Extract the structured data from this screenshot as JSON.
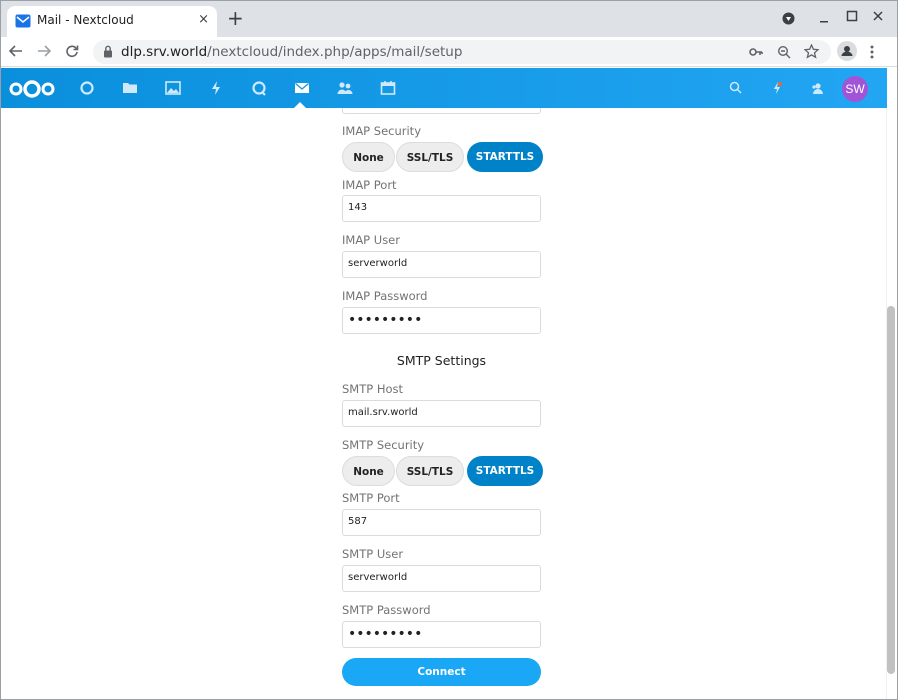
{
  "browser": {
    "tab_title": "Mail - Nextcloud",
    "tab_close": "×",
    "new_tab": "+",
    "url_host": "dlp.srv.world",
    "url_path": "/nextcloud/index.php/apps/mail/setup"
  },
  "header": {
    "avatar_initials": "SW",
    "accent_color": "#0082c9"
  },
  "imap": {
    "security_label": "IMAP Security",
    "security_options": [
      "None",
      "SSL/TLS",
      "STARTTLS"
    ],
    "security_selected": "STARTTLS",
    "port_label": "IMAP Port",
    "port_value": "143",
    "user_label": "IMAP User",
    "user_value": "serverworld",
    "password_label": "IMAP Password",
    "password_value": "•••••••••"
  },
  "smtp": {
    "section_title": "SMTP Settings",
    "host_label": "SMTP Host",
    "host_value": "mail.srv.world",
    "security_label": "SMTP Security",
    "security_options": [
      "None",
      "SSL/TLS",
      "STARTTLS"
    ],
    "security_selected": "STARTTLS",
    "port_label": "SMTP Port",
    "port_value": "587",
    "user_label": "SMTP User",
    "user_value": "serverworld",
    "password_label": "SMTP Password",
    "password_value": "•••••••••"
  },
  "actions": {
    "connect_label": "Connect"
  }
}
